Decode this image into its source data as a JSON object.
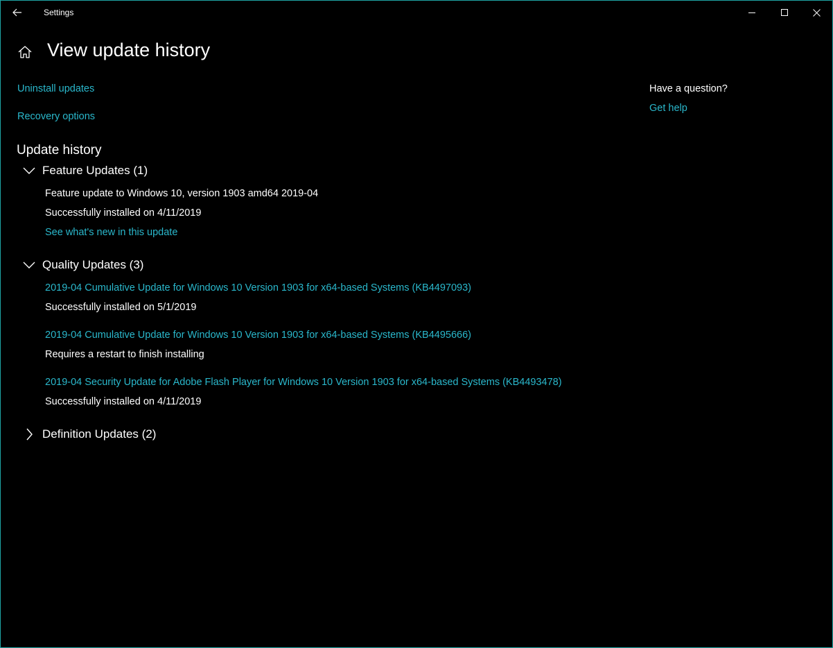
{
  "window": {
    "title": "Settings"
  },
  "icons": {
    "back": "back-arrow-icon",
    "home": "home-icon",
    "minimize": "minimize-icon",
    "maximize": "maximize-icon",
    "close": "close-icon",
    "chevron_down": "chevron-down-icon",
    "chevron_right": "chevron-right-icon"
  },
  "colors": {
    "background": "#000000",
    "link": "#2ab8cc",
    "border": "#1fa5a5",
    "text": "#ffffff"
  },
  "header": {
    "title": "View update history"
  },
  "links": {
    "uninstall": "Uninstall updates",
    "recovery": "Recovery options"
  },
  "help": {
    "title": "Have a question?",
    "link": "Get help"
  },
  "history": {
    "heading": "Update history",
    "groups": [
      {
        "label": "Feature Updates (1)",
        "expanded": true,
        "items": [
          {
            "name": "Feature update to Windows 10, version 1903 amd64 2019-04",
            "status": "Successfully installed on 4/11/2019",
            "link": "See what's new in this update"
          }
        ]
      },
      {
        "label": "Quality Updates (3)",
        "expanded": true,
        "items": [
          {
            "name": "2019-04 Cumulative Update for Windows 10 Version 1903 for x64-based Systems (KB4497093)",
            "status": "Successfully installed on 5/1/2019"
          },
          {
            "name": "2019-04 Cumulative Update for Windows 10 Version 1903 for x64-based Systems (KB4495666)",
            "status": "Requires a restart to finish installing"
          },
          {
            "name": "2019-04 Security Update for Adobe Flash Player for Windows 10 Version 1903 for x64-based Systems (KB4493478)",
            "status": "Successfully installed on 4/11/2019"
          }
        ]
      },
      {
        "label": "Definition Updates (2)",
        "expanded": false,
        "items": []
      }
    ]
  }
}
